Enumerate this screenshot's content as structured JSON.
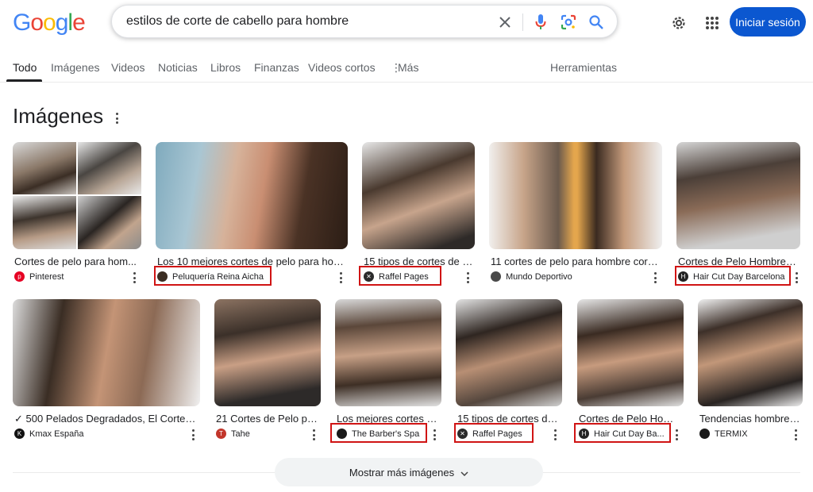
{
  "search": {
    "query": "estilos de corte de cabello para hombre"
  },
  "header": {
    "logo": "Google",
    "signin": "Iniciar sesión"
  },
  "tabs": [
    {
      "label": "Todo"
    },
    {
      "label": "Imágenes"
    },
    {
      "label": "Videos"
    },
    {
      "label": "Noticias"
    },
    {
      "label": "Libros"
    },
    {
      "label": "Finanzas"
    },
    {
      "label": "Videos cortos"
    },
    {
      "label": "Más"
    }
  ],
  "tools_label": "Herramientas",
  "section": {
    "title": "Imágenes"
  },
  "images": [
    {
      "title": "Cortes de pelo para hom...",
      "source": "Pinterest",
      "favicon_color": "#e60023",
      "favicon_icon": "pinterest-logo-icon"
    },
    {
      "title": "Los 10 mejores cortes de pelo para hom...",
      "source": "Peluquería Reina Aicha",
      "favicon_color": "#3b2d22",
      "favicon_icon": "salon-logo-icon"
    },
    {
      "title": "15 tipos de cortes de p...",
      "source": "Raffel Pages",
      "favicon_color": "#2b2b2b",
      "favicon_icon": "barber-logo-icon"
    },
    {
      "title": "11 cortes de pelo para hombre corto...",
      "source": "Mundo Deportivo",
      "favicon_color": "#4a4a4a",
      "favicon_icon": "mundo-deportivo-logo-icon"
    },
    {
      "title": "Cortes de Pelo Hombre e...",
      "source": "Hair Cut Day Barcelona",
      "favicon_color": "#222222",
      "favicon_icon": "hcd-logo-icon"
    },
    {
      "title": "✓ 500 Pelados Degradados, El Corte d...",
      "source": "Kmax España",
      "favicon_color": "#111111",
      "favicon_icon": "kmax-logo-icon"
    },
    {
      "title": "21 Cortes de Pelo par...",
      "source": "Tahe",
      "favicon_color": "#c2362b",
      "favicon_icon": "tahe-logo-icon"
    },
    {
      "title": "Los mejores cortes d...",
      "source": "The Barber's Spa",
      "favicon_color": "#1a1a1a",
      "favicon_icon": "barbers-spa-logo-icon"
    },
    {
      "title": "15 tipos de cortes de ...",
      "source": "Raffel Pages",
      "favicon_color": "#2b2b2b",
      "favicon_icon": "barber-logo-icon"
    },
    {
      "title": "Cortes de Pelo Homb...",
      "source": "Hair Cut Day Ba...",
      "favicon_color": "#222222",
      "favicon_icon": "hcd-logo-icon"
    },
    {
      "title": "Tendencias hombres:...",
      "source": "TERMIX",
      "favicon_color": "#1a1a1a",
      "favicon_icon": "termix-logo-icon"
    }
  ],
  "show_more": "Mostrar más imágenes",
  "colors": {
    "accent": "#0b57d0",
    "highlight": "#d01414"
  }
}
